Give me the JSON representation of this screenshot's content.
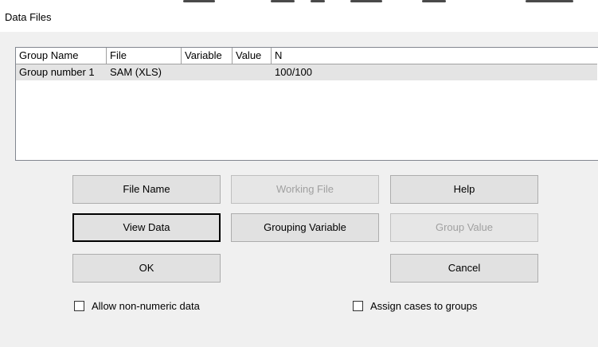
{
  "window": {
    "title": "Data Files"
  },
  "list": {
    "columns": [
      "Group Name",
      "File",
      "Variable",
      "Value",
      "N"
    ],
    "rows": [
      {
        "group_name": "Group number 1",
        "file": "SAM (XLS)",
        "variable": "",
        "value": "",
        "n": "100/100",
        "selected": true
      }
    ]
  },
  "buttons": {
    "file_name": "File Name",
    "working_file": "Working File",
    "help": "Help",
    "view_data": "View Data",
    "grouping_variable": "Grouping Variable",
    "group_value": "Group Value",
    "ok": "OK",
    "cancel": "Cancel"
  },
  "checkboxes": {
    "allow_non_numeric": {
      "label": "Allow non-numeric data",
      "checked": false
    },
    "assign_cases": {
      "label": "Assign cases to groups",
      "checked": false
    }
  },
  "colors": {
    "dialog_bg": "#f0f0f0",
    "selected_row": "#e4e4e4",
    "button_bg": "#e1e1e1",
    "disabled_text": "#a0a0a0"
  }
}
